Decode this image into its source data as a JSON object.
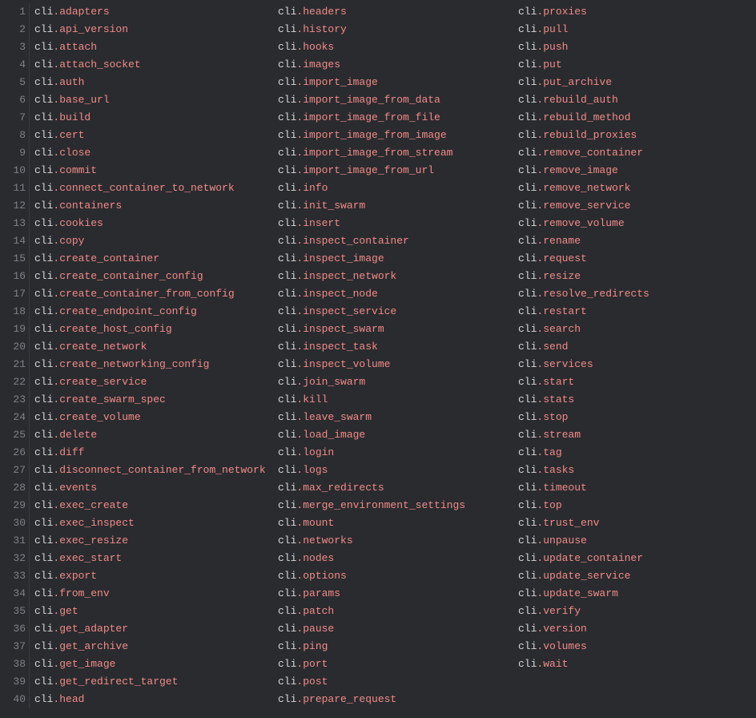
{
  "line_count": 40,
  "columns": [
    [
      {
        "obj": "cli",
        "attr": "adapters"
      },
      {
        "obj": "cli",
        "attr": "api_version"
      },
      {
        "obj": "cli",
        "attr": "attach"
      },
      {
        "obj": "cli",
        "attr": "attach_socket"
      },
      {
        "obj": "cli",
        "attr": "auth"
      },
      {
        "obj": "cli",
        "attr": "base_url"
      },
      {
        "obj": "cli",
        "attr": "build"
      },
      {
        "obj": "cli",
        "attr": "cert"
      },
      {
        "obj": "cli",
        "attr": "close"
      },
      {
        "obj": "cli",
        "attr": "commit"
      },
      {
        "obj": "cli",
        "attr": "connect_container_to_network"
      },
      {
        "obj": "cli",
        "attr": "containers"
      },
      {
        "obj": "cli",
        "attr": "cookies"
      },
      {
        "obj": "cli",
        "attr": "copy"
      },
      {
        "obj": "cli",
        "attr": "create_container"
      },
      {
        "obj": "cli",
        "attr": "create_container_config"
      },
      {
        "obj": "cli",
        "attr": "create_container_from_config"
      },
      {
        "obj": "cli",
        "attr": "create_endpoint_config"
      },
      {
        "obj": "cli",
        "attr": "create_host_config"
      },
      {
        "obj": "cli",
        "attr": "create_network"
      },
      {
        "obj": "cli",
        "attr": "create_networking_config"
      },
      {
        "obj": "cli",
        "attr": "create_service"
      },
      {
        "obj": "cli",
        "attr": "create_swarm_spec"
      },
      {
        "obj": "cli",
        "attr": "create_volume"
      },
      {
        "obj": "cli",
        "attr": "delete"
      },
      {
        "obj": "cli",
        "attr": "diff"
      },
      {
        "obj": "cli",
        "attr": "disconnect_container_from_network"
      },
      {
        "obj": "cli",
        "attr": "events"
      },
      {
        "obj": "cli",
        "attr": "exec_create"
      },
      {
        "obj": "cli",
        "attr": "exec_inspect"
      },
      {
        "obj": "cli",
        "attr": "exec_resize"
      },
      {
        "obj": "cli",
        "attr": "exec_start"
      },
      {
        "obj": "cli",
        "attr": "export"
      },
      {
        "obj": "cli",
        "attr": "from_env"
      },
      {
        "obj": "cli",
        "attr": "get"
      },
      {
        "obj": "cli",
        "attr": "get_adapter"
      },
      {
        "obj": "cli",
        "attr": "get_archive"
      },
      {
        "obj": "cli",
        "attr": "get_image"
      },
      {
        "obj": "cli",
        "attr": "get_redirect_target"
      },
      {
        "obj": "cli",
        "attr": "head"
      }
    ],
    [
      {
        "obj": "cli",
        "attr": "headers"
      },
      {
        "obj": "cli",
        "attr": "history"
      },
      {
        "obj": "cli",
        "attr": "hooks"
      },
      {
        "obj": "cli",
        "attr": "images"
      },
      {
        "obj": "cli",
        "attr": "import_image"
      },
      {
        "obj": "cli",
        "attr": "import_image_from_data"
      },
      {
        "obj": "cli",
        "attr": "import_image_from_file"
      },
      {
        "obj": "cli",
        "attr": "import_image_from_image"
      },
      {
        "obj": "cli",
        "attr": "import_image_from_stream"
      },
      {
        "obj": "cli",
        "attr": "import_image_from_url"
      },
      {
        "obj": "cli",
        "attr": "info"
      },
      {
        "obj": "cli",
        "attr": "init_swarm"
      },
      {
        "obj": "cli",
        "attr": "insert"
      },
      {
        "obj": "cli",
        "attr": "inspect_container"
      },
      {
        "obj": "cli",
        "attr": "inspect_image"
      },
      {
        "obj": "cli",
        "attr": "inspect_network"
      },
      {
        "obj": "cli",
        "attr": "inspect_node"
      },
      {
        "obj": "cli",
        "attr": "inspect_service"
      },
      {
        "obj": "cli",
        "attr": "inspect_swarm"
      },
      {
        "obj": "cli",
        "attr": "inspect_task"
      },
      {
        "obj": "cli",
        "attr": "inspect_volume"
      },
      {
        "obj": "cli",
        "attr": "join_swarm"
      },
      {
        "obj": "cli",
        "attr": "kill"
      },
      {
        "obj": "cli",
        "attr": "leave_swarm"
      },
      {
        "obj": "cli",
        "attr": "load_image"
      },
      {
        "obj": "cli",
        "attr": "login"
      },
      {
        "obj": "cli",
        "attr": "logs"
      },
      {
        "obj": "cli",
        "attr": "max_redirects"
      },
      {
        "obj": "cli",
        "attr": "merge_environment_settings"
      },
      {
        "obj": "cli",
        "attr": "mount"
      },
      {
        "obj": "cli",
        "attr": "networks"
      },
      {
        "obj": "cli",
        "attr": "nodes"
      },
      {
        "obj": "cli",
        "attr": "options"
      },
      {
        "obj": "cli",
        "attr": "params"
      },
      {
        "obj": "cli",
        "attr": "patch"
      },
      {
        "obj": "cli",
        "attr": "pause"
      },
      {
        "obj": "cli",
        "attr": "ping"
      },
      {
        "obj": "cli",
        "attr": "port"
      },
      {
        "obj": "cli",
        "attr": "post"
      },
      {
        "obj": "cli",
        "attr": "prepare_request"
      }
    ],
    [
      {
        "obj": "cli",
        "attr": "proxies"
      },
      {
        "obj": "cli",
        "attr": "pull"
      },
      {
        "obj": "cli",
        "attr": "push"
      },
      {
        "obj": "cli",
        "attr": "put"
      },
      {
        "obj": "cli",
        "attr": "put_archive"
      },
      {
        "obj": "cli",
        "attr": "rebuild_auth"
      },
      {
        "obj": "cli",
        "attr": "rebuild_method"
      },
      {
        "obj": "cli",
        "attr": "rebuild_proxies"
      },
      {
        "obj": "cli",
        "attr": "remove_container"
      },
      {
        "obj": "cli",
        "attr": "remove_image"
      },
      {
        "obj": "cli",
        "attr": "remove_network"
      },
      {
        "obj": "cli",
        "attr": "remove_service"
      },
      {
        "obj": "cli",
        "attr": "remove_volume"
      },
      {
        "obj": "cli",
        "attr": "rename"
      },
      {
        "obj": "cli",
        "attr": "request"
      },
      {
        "obj": "cli",
        "attr": "resize"
      },
      {
        "obj": "cli",
        "attr": "resolve_redirects"
      },
      {
        "obj": "cli",
        "attr": "restart"
      },
      {
        "obj": "cli",
        "attr": "search"
      },
      {
        "obj": "cli",
        "attr": "send"
      },
      {
        "obj": "cli",
        "attr": "services"
      },
      {
        "obj": "cli",
        "attr": "start"
      },
      {
        "obj": "cli",
        "attr": "stats"
      },
      {
        "obj": "cli",
        "attr": "stop"
      },
      {
        "obj": "cli",
        "attr": "stream"
      },
      {
        "obj": "cli",
        "attr": "tag"
      },
      {
        "obj": "cli",
        "attr": "tasks"
      },
      {
        "obj": "cli",
        "attr": "timeout"
      },
      {
        "obj": "cli",
        "attr": "top"
      },
      {
        "obj": "cli",
        "attr": "trust_env"
      },
      {
        "obj": "cli",
        "attr": "unpause"
      },
      {
        "obj": "cli",
        "attr": "update_container"
      },
      {
        "obj": "cli",
        "attr": "update_service"
      },
      {
        "obj": "cli",
        "attr": "update_swarm"
      },
      {
        "obj": "cli",
        "attr": "verify"
      },
      {
        "obj": "cli",
        "attr": "version"
      },
      {
        "obj": "cli",
        "attr": "volumes"
      },
      {
        "obj": "cli",
        "attr": "wait"
      }
    ]
  ]
}
